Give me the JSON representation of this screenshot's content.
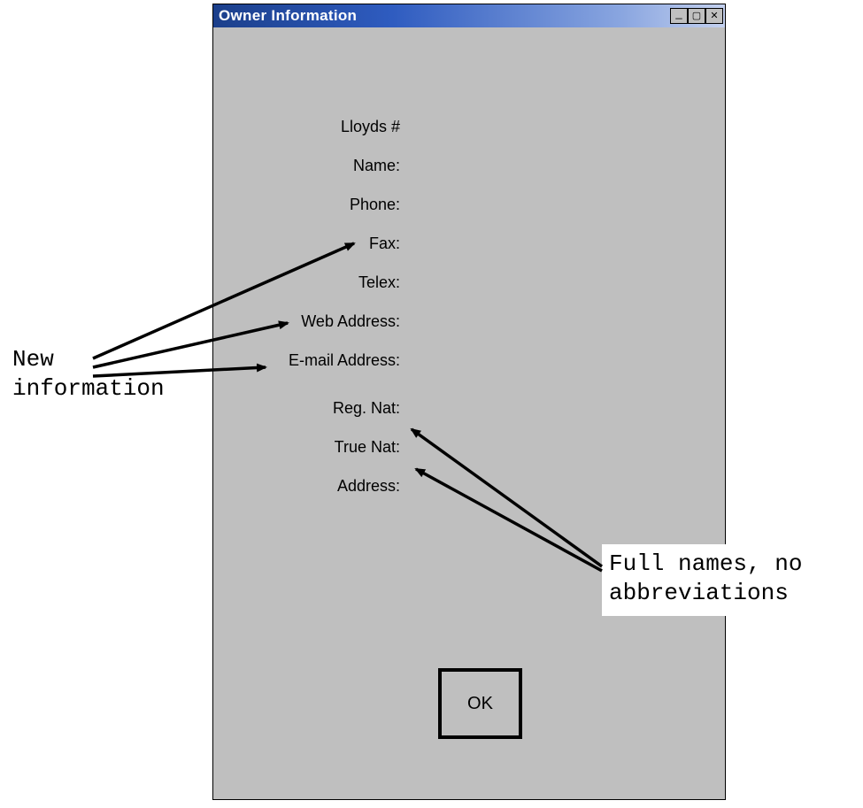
{
  "window": {
    "title": "Owner Information",
    "buttons": {
      "min": "minimize",
      "max": "maximize",
      "close": "close"
    }
  },
  "form": {
    "labels": {
      "lloyds": "Lloyds #",
      "name": "Name:",
      "phone": "Phone:",
      "fax": "Fax:",
      "telex": "Telex:",
      "web": "Web Address:",
      "email": "E-mail Address:",
      "regnat": "Reg. Nat:",
      "truenat": "True Nat:",
      "address": "Address:"
    },
    "ok_label": "OK"
  },
  "annotations": {
    "left_line1": "New",
    "left_line2": "information",
    "right_line1": "Full names, no",
    "right_line2": "abbreviations"
  }
}
